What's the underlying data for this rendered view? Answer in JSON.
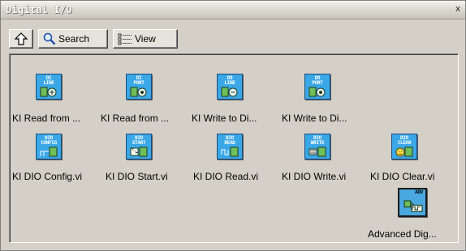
{
  "window": {
    "title": "Digital I/O",
    "close_glyph": "x"
  },
  "toolbar": {
    "up_icon": "up-arrow-icon",
    "search_label": "Search",
    "search_icon": "magnifier-icon",
    "view_label": "View",
    "view_icon": "view-list-icon"
  },
  "colors": {
    "icon_fill": "#3aa7e6",
    "icon_border": "#1a4d80",
    "pane_bg": "#d4d0c8"
  },
  "palette": {
    "items": [
      {
        "icon_text_1": "DI",
        "icon_text_2": "LINE",
        "icon": "digital-input-line-icon",
        "label": "KI Read from ..."
      },
      {
        "icon_text_1": "DI",
        "icon_text_2": "PORT",
        "icon": "digital-input-port-icon",
        "label": "KI Read from ..."
      },
      {
        "icon_text_1": "DO",
        "icon_text_2": "LINE",
        "icon": "digital-output-line-icon",
        "label": "KI Write to Di..."
      },
      {
        "icon_text_1": "DO",
        "icon_text_2": "PORT",
        "icon": "digital-output-port-icon",
        "label": "KI Write to Di..."
      },
      {
        "icon_text_1": "DIO",
        "icon_text_2": "CONFIG",
        "icon": "dio-config-icon",
        "label": "KI DIO Config.vi"
      },
      {
        "icon_text_1": "DIO",
        "icon_text_2": "START",
        "icon": "dio-start-icon",
        "label": "KI DIO Start.vi"
      },
      {
        "icon_text_1": "DIO",
        "icon_text_2": "READ",
        "icon": "dio-read-icon",
        "label": "KI DIO Read.vi"
      },
      {
        "icon_text_1": "DIO",
        "icon_text_2": "WRITE",
        "icon": "dio-write-icon",
        "label": "KI DIO Write.vi"
      },
      {
        "icon_text_1": "DIO",
        "icon_text_2": "CLEAR",
        "icon": "dio-clear-icon",
        "label": "KI DIO Clear.vi"
      },
      {
        "icon_text_1": "ADV",
        "icon_text_2": "",
        "icon": "advanced-digital-folder-icon",
        "label": "Advanced Dig..."
      }
    ]
  }
}
